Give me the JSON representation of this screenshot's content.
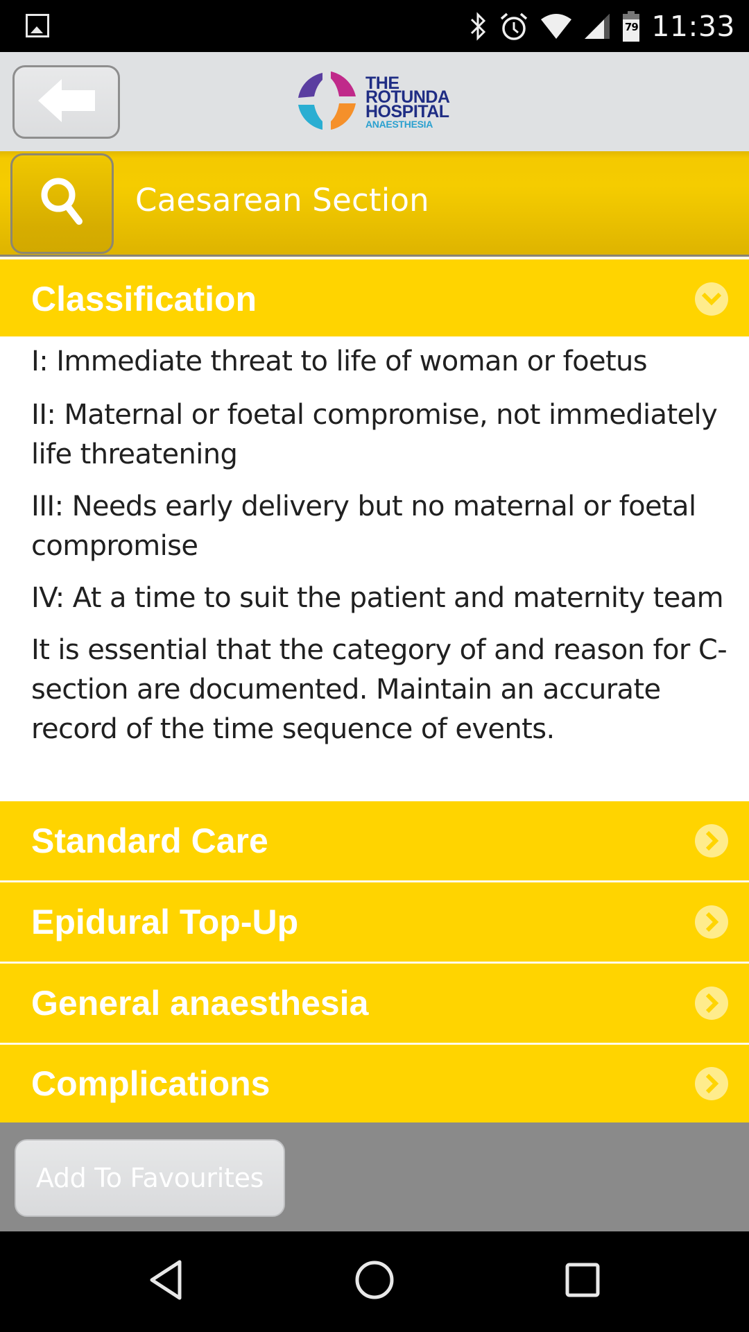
{
  "status_bar": {
    "time": "11:33",
    "battery_level": "79",
    "icons": [
      "gallery-icon",
      "bluetooth-icon",
      "alarm-icon",
      "wifi-icon",
      "cell-signal-icon",
      "battery-icon"
    ]
  },
  "header": {
    "back_button_icon": "arrow-left-icon",
    "logo": {
      "line1": "THE",
      "line2": "ROTUNDA",
      "line3": "HOSPITAL",
      "subtitle": "ANAESTHESIA"
    }
  },
  "search_bar": {
    "icon": "search-icon",
    "title": "Caesarean Section"
  },
  "sections": [
    {
      "title": "Classification",
      "expanded": true,
      "icon": "chevron-down-circle-icon",
      "content": [
        "I: Immediate threat to life of woman or foetus",
        "II: Maternal or foetal compromise, not immediately life threatening",
        "III: Needs early delivery but no maternal or foetal compromise",
        "IV: At a time to suit the patient and maternity team",
        "It is essential that the category of and reason for C-section are documented. Maintain an accurate record of the time sequence of events."
      ]
    },
    {
      "title": "Standard Care",
      "expanded": false,
      "icon": "chevron-right-circle-icon"
    },
    {
      "title": "Epidural Top-Up",
      "expanded": false,
      "icon": "chevron-right-circle-icon"
    },
    {
      "title": "General anaesthesia",
      "expanded": false,
      "icon": "chevron-right-circle-icon"
    },
    {
      "title": "Complications",
      "expanded": false,
      "icon": "chevron-right-circle-icon"
    }
  ],
  "footer": {
    "favourites_label": "Add To Favourites"
  },
  "colors": {
    "accent_yellow": "#ffd400",
    "header_grey": "#dfe1e3",
    "footer_grey": "#8a8a8a",
    "logo_navy": "#1f2d84",
    "logo_cyan": "#2aa0cf"
  },
  "nav_bar": {
    "buttons": [
      "back-triangle-icon",
      "home-circle-icon",
      "recents-square-icon"
    ]
  }
}
